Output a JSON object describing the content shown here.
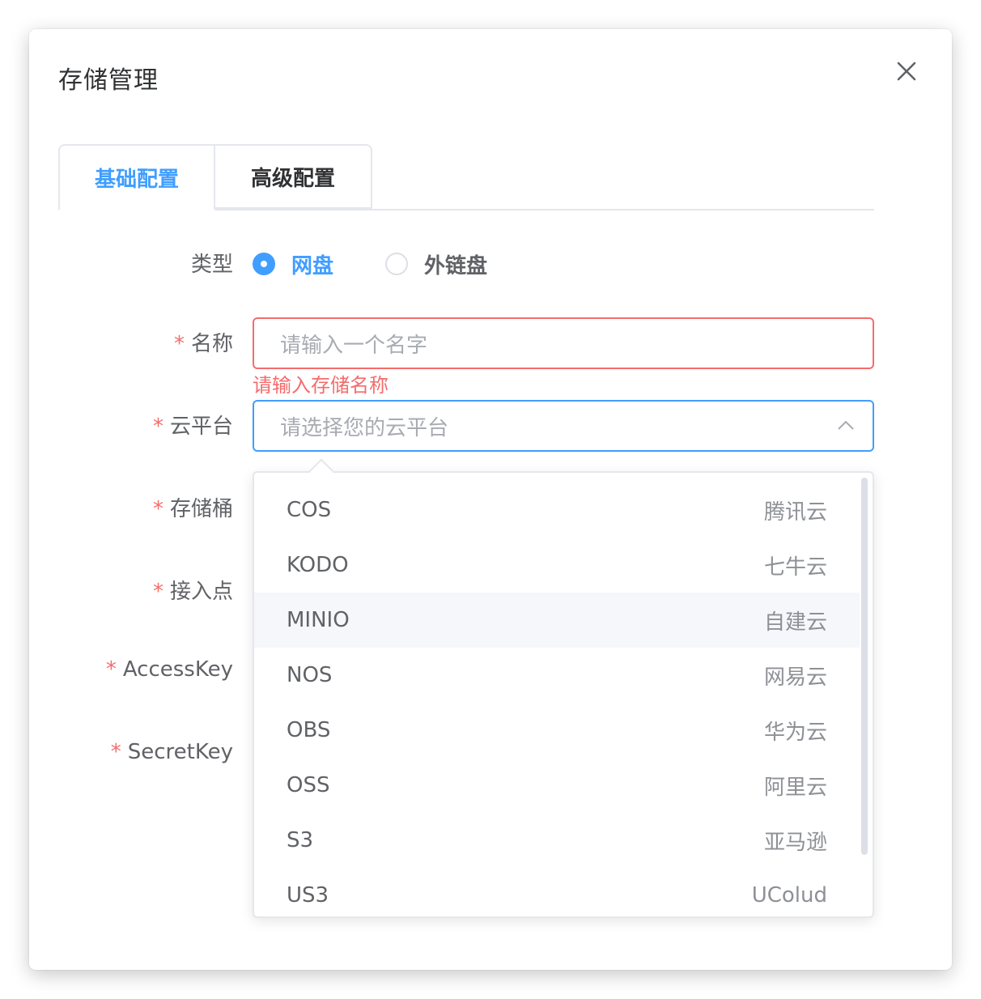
{
  "dialog": {
    "title": "存储管理"
  },
  "tabs": [
    {
      "label": "基础配置",
      "active": true
    },
    {
      "label": "高级配置",
      "active": false
    }
  ],
  "form": {
    "type_label": "类型",
    "type_options": [
      {
        "label": "网盘",
        "checked": true
      },
      {
        "label": "外链盘",
        "checked": false
      }
    ],
    "required_mark": "*",
    "name_label": "名称",
    "name_placeholder": "请输入一个名字",
    "name_error": "请输入存储名称",
    "platform_label": "云平台",
    "platform_placeholder": "请选择您的云平台",
    "bucket_label": "存储桶",
    "endpoint_label": "接入点",
    "accesskey_label": "AccessKey",
    "secretkey_label": "SecretKey"
  },
  "platform_options": [
    {
      "code": "COS",
      "vendor": "腾讯云"
    },
    {
      "code": "KODO",
      "vendor": "七牛云"
    },
    {
      "code": "MINIO",
      "vendor": "自建云",
      "hovered": true
    },
    {
      "code": "NOS",
      "vendor": "网易云"
    },
    {
      "code": "OBS",
      "vendor": "华为云"
    },
    {
      "code": "OSS",
      "vendor": "阿里云"
    },
    {
      "code": "S3",
      "vendor": "亚马逊"
    },
    {
      "code": "US3",
      "vendor": "UColud"
    }
  ],
  "colors": {
    "primary": "#409eff",
    "danger": "#f56c6c",
    "text": "#606266",
    "placeholder": "#a8abb2"
  }
}
